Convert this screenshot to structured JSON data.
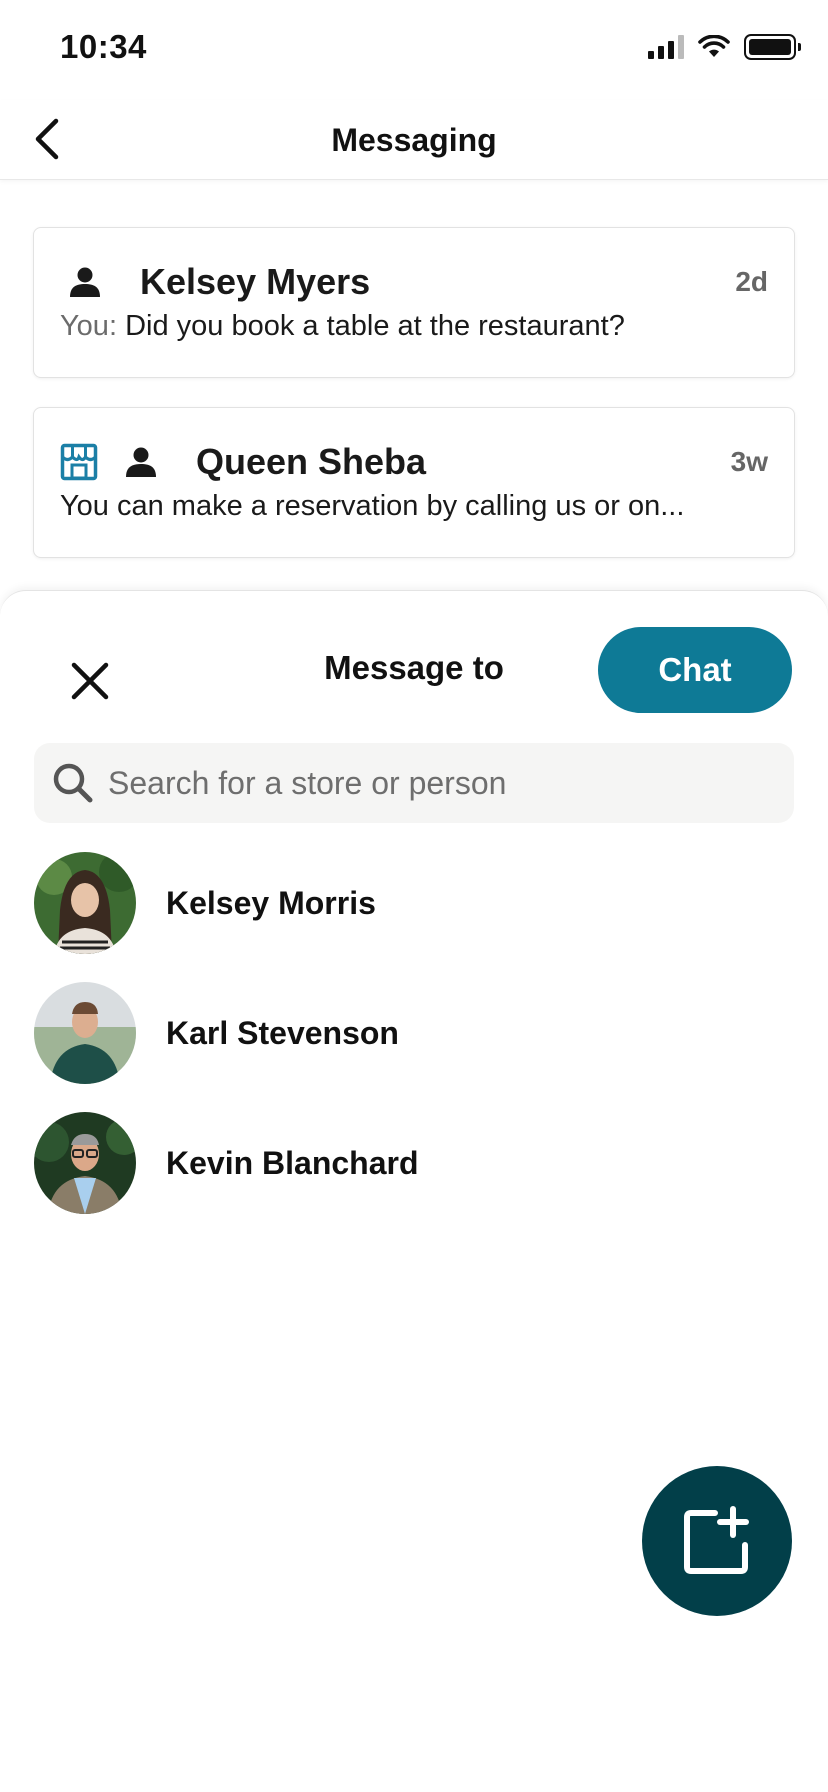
{
  "status_bar": {
    "time": "10:34"
  },
  "header": {
    "title": "Messaging"
  },
  "conversations": [
    {
      "name": "Kelsey Myers",
      "time": "2d",
      "preview_prefix": "You:",
      "preview": "Did you book a table at the restaurant?",
      "is_store": false
    },
    {
      "name": "Queen Sheba",
      "time": "3w",
      "preview_prefix": "",
      "preview": "You can make a reservation by calling us or on...",
      "is_store": true
    }
  ],
  "sheet": {
    "title": "Message to",
    "chat_label": "Chat",
    "search_placeholder": "Search for a store or person",
    "contacts": [
      {
        "name": "Kelsey Morris"
      },
      {
        "name": "Karl Stevenson"
      },
      {
        "name": "Kevin Blanchard"
      }
    ]
  },
  "colors": {
    "accent": "#0e7a96",
    "fab": "#023f49",
    "store_icon": "#1b7fa6"
  }
}
